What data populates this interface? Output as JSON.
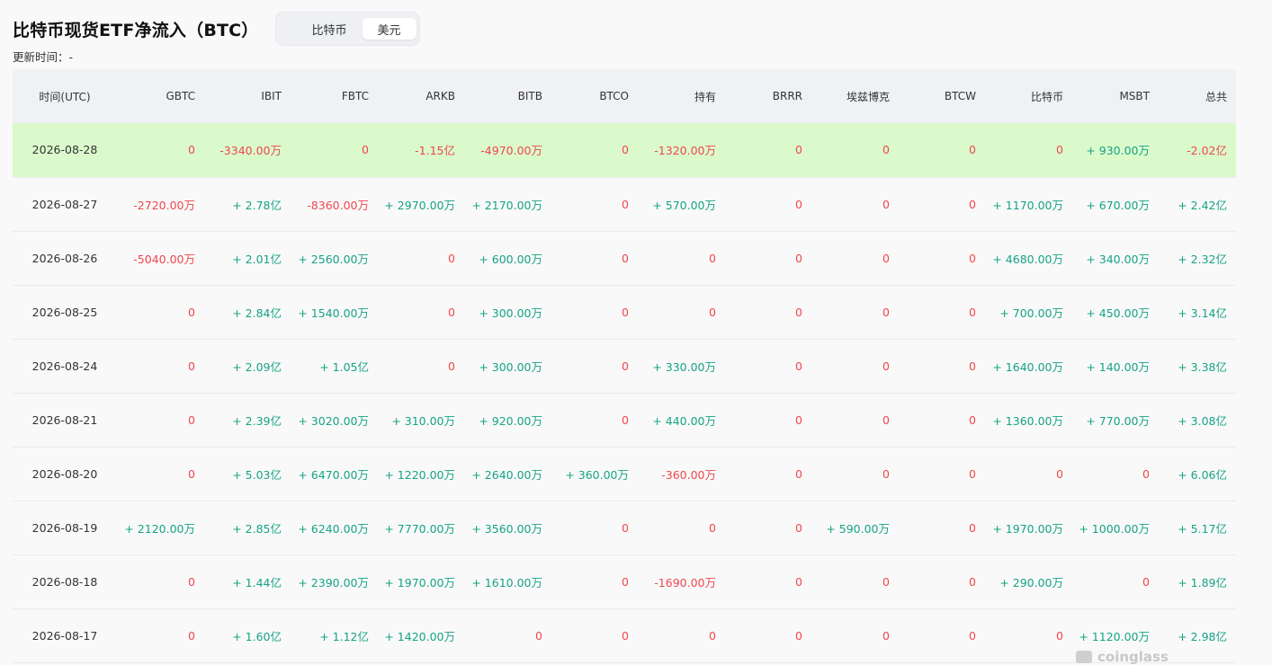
{
  "header": {
    "title": "比特币现货ETF净流入（BTC）",
    "toggle": [
      "比特币",
      "美元"
    ],
    "active_index": 1,
    "updated_label": "更新时间：-"
  },
  "table": {
    "columns": [
      "时间(UTC)",
      "GBTC",
      "IBIT",
      "FBTC",
      "ARKB",
      "BITB",
      "BTCO",
      "持有",
      "BRRR",
      "埃兹博克",
      "BTCW",
      "比特币",
      "MSBT",
      "总共"
    ],
    "rows": [
      [
        "2026-08-28",
        "0",
        "-3340.00万",
        "0",
        "-1.15亿",
        "-4970.00万",
        "0",
        "-1320.00万",
        "0",
        "0",
        "0",
        "0",
        "+ 930.00万",
        "-2.02亿"
      ],
      [
        "2026-08-27",
        "-2720.00万",
        "+ 2.78亿",
        "-8360.00万",
        "+ 2970.00万",
        "+ 2170.00万",
        "0",
        "+ 570.00万",
        "0",
        "0",
        "0",
        "+ 1170.00万",
        "+ 670.00万",
        "+ 2.42亿"
      ],
      [
        "2026-08-26",
        "-5040.00万",
        "+ 2.01亿",
        "+ 2560.00万",
        "0",
        "+ 600.00万",
        "0",
        "0",
        "0",
        "0",
        "0",
        "+ 4680.00万",
        "+ 340.00万",
        "+ 2.32亿"
      ],
      [
        "2026-08-25",
        "0",
        "+ 2.84亿",
        "+ 1540.00万",
        "0",
        "+ 300.00万",
        "0",
        "0",
        "0",
        "0",
        "0",
        "+ 700.00万",
        "+ 450.00万",
        "+ 3.14亿"
      ],
      [
        "2026-08-24",
        "0",
        "+ 2.09亿",
        "+ 1.05亿",
        "0",
        "+ 300.00万",
        "0",
        "+ 330.00万",
        "0",
        "0",
        "0",
        "+ 1640.00万",
        "+ 140.00万",
        "+ 3.38亿"
      ],
      [
        "2026-08-21",
        "0",
        "+ 2.39亿",
        "+ 3020.00万",
        "+ 310.00万",
        "+ 920.00万",
        "0",
        "+ 440.00万",
        "0",
        "0",
        "0",
        "+ 1360.00万",
        "+ 770.00万",
        "+ 3.08亿"
      ],
      [
        "2026-08-20",
        "0",
        "+ 5.03亿",
        "+ 6470.00万",
        "+ 1220.00万",
        "+ 2640.00万",
        "+ 360.00万",
        "-360.00万",
        "0",
        "0",
        "0",
        "0",
        "0",
        "+ 6.06亿"
      ],
      [
        "2026-08-19",
        "+ 2120.00万",
        "+ 2.85亿",
        "+ 6240.00万",
        "+ 7770.00万",
        "+ 3560.00万",
        "0",
        "0",
        "0",
        "+ 590.00万",
        "0",
        "+ 1970.00万",
        "+ 1000.00万",
        "+ 5.17亿"
      ],
      [
        "2026-08-18",
        "0",
        "+ 1.44亿",
        "+ 2390.00万",
        "+ 1970.00万",
        "+ 1610.00万",
        "0",
        "-1690.00万",
        "0",
        "0",
        "0",
        "+ 290.00万",
        "0",
        "+ 1.89亿"
      ],
      [
        "2026-08-17",
        "0",
        "+ 1.60亿",
        "+ 1.12亿",
        "+ 1420.00万",
        "0",
        "0",
        "0",
        "0",
        "0",
        "0",
        "0",
        "+ 1120.00万",
        "+ 2.98亿"
      ]
    ],
    "highlight_row": 0,
    "colors": {
      "positive": "#16a385",
      "negative": "#f0464d",
      "highlight": "#dafacc",
      "header_bg": "#eff1f4"
    }
  },
  "watermark": "coinglass"
}
